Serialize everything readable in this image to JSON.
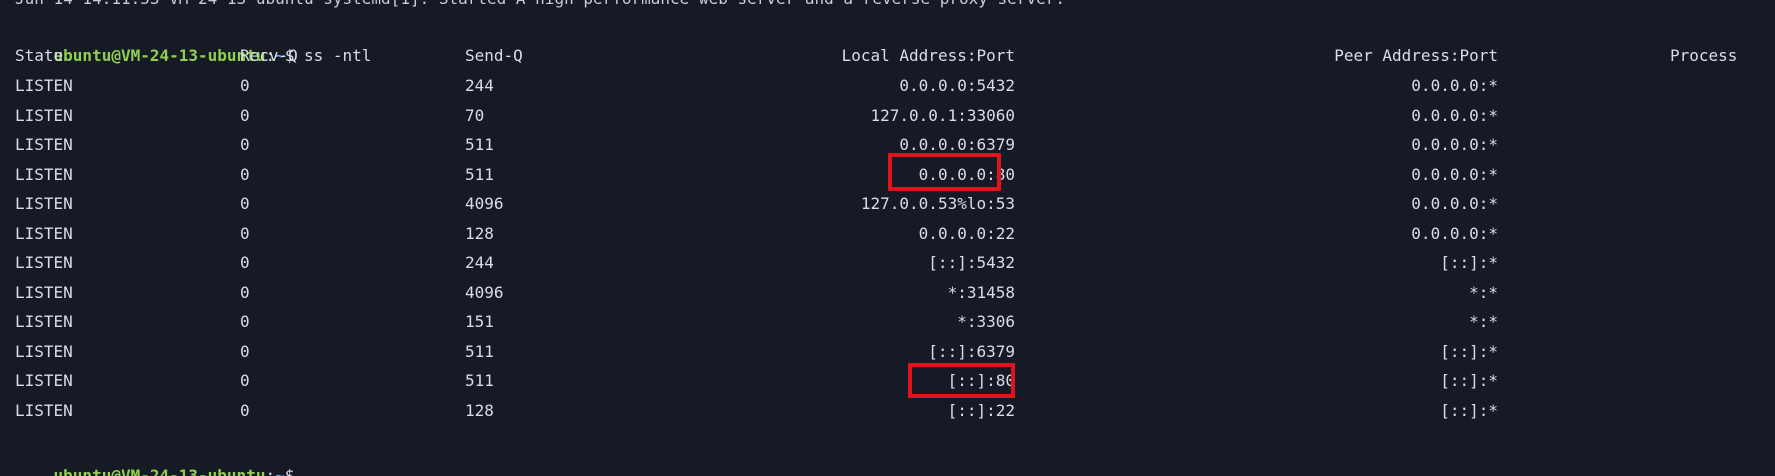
{
  "terminal": {
    "top_line": "Jun 14 14:11:53 VM-24-13-ubuntu systemd[1]: Started A high performance web server and a reverse proxy server.",
    "prompt": {
      "user_host": "ubuntu@VM-24-13-ubuntu",
      "separator": ":",
      "path": "~",
      "symbol": "$"
    },
    "command": " ss -ntl",
    "headers": {
      "state": "State",
      "recv_q": "Recv-Q",
      "send_q": "Send-Q",
      "local": "Local Address:Port",
      "peer": "Peer Address:Port",
      "process": "Process"
    },
    "rows": [
      {
        "state": "LISTEN",
        "recv_q": "0",
        "send_q": "244",
        "local": "0.0.0.0:5432",
        "peer": "0.0.0.0:*"
      },
      {
        "state": "LISTEN",
        "recv_q": "0",
        "send_q": "70",
        "local": "127.0.0.1:33060",
        "peer": "0.0.0.0:*"
      },
      {
        "state": "LISTEN",
        "recv_q": "0",
        "send_q": "511",
        "local": "0.0.0.0:6379",
        "peer": "0.0.0.0:*"
      },
      {
        "state": "LISTEN",
        "recv_q": "0",
        "send_q": "511",
        "local": "0.0.0.0:80",
        "peer": "0.0.0.0:*"
      },
      {
        "state": "LISTEN",
        "recv_q": "0",
        "send_q": "4096",
        "local": "127.0.0.53%lo:53",
        "peer": "0.0.0.0:*"
      },
      {
        "state": "LISTEN",
        "recv_q": "0",
        "send_q": "128",
        "local": "0.0.0.0:22",
        "peer": "0.0.0.0:*"
      },
      {
        "state": "LISTEN",
        "recv_q": "0",
        "send_q": "244",
        "local": "[::]:5432",
        "peer": "[::]:*"
      },
      {
        "state": "LISTEN",
        "recv_q": "0",
        "send_q": "4096",
        "local": "*:31458",
        "peer": "*:*"
      },
      {
        "state": "LISTEN",
        "recv_q": "0",
        "send_q": "151",
        "local": "*:3306",
        "peer": "*:*"
      },
      {
        "state": "LISTEN",
        "recv_q": "0",
        "send_q": "511",
        "local": "[::]:6379",
        "peer": "[::]:*"
      },
      {
        "state": "LISTEN",
        "recv_q": "0",
        "send_q": "511",
        "local": "[::]:80",
        "peer": "[::]:*"
      },
      {
        "state": "LISTEN",
        "recv_q": "0",
        "send_q": "128",
        "local": "[::]:22",
        "peer": "[::]:*"
      }
    ],
    "colors": {
      "background": "#161a25",
      "text": "#d9dde6",
      "prompt_user": "#8fd14f",
      "prompt_path": "#6f9fe8",
      "highlight": "#e0141e"
    }
  }
}
